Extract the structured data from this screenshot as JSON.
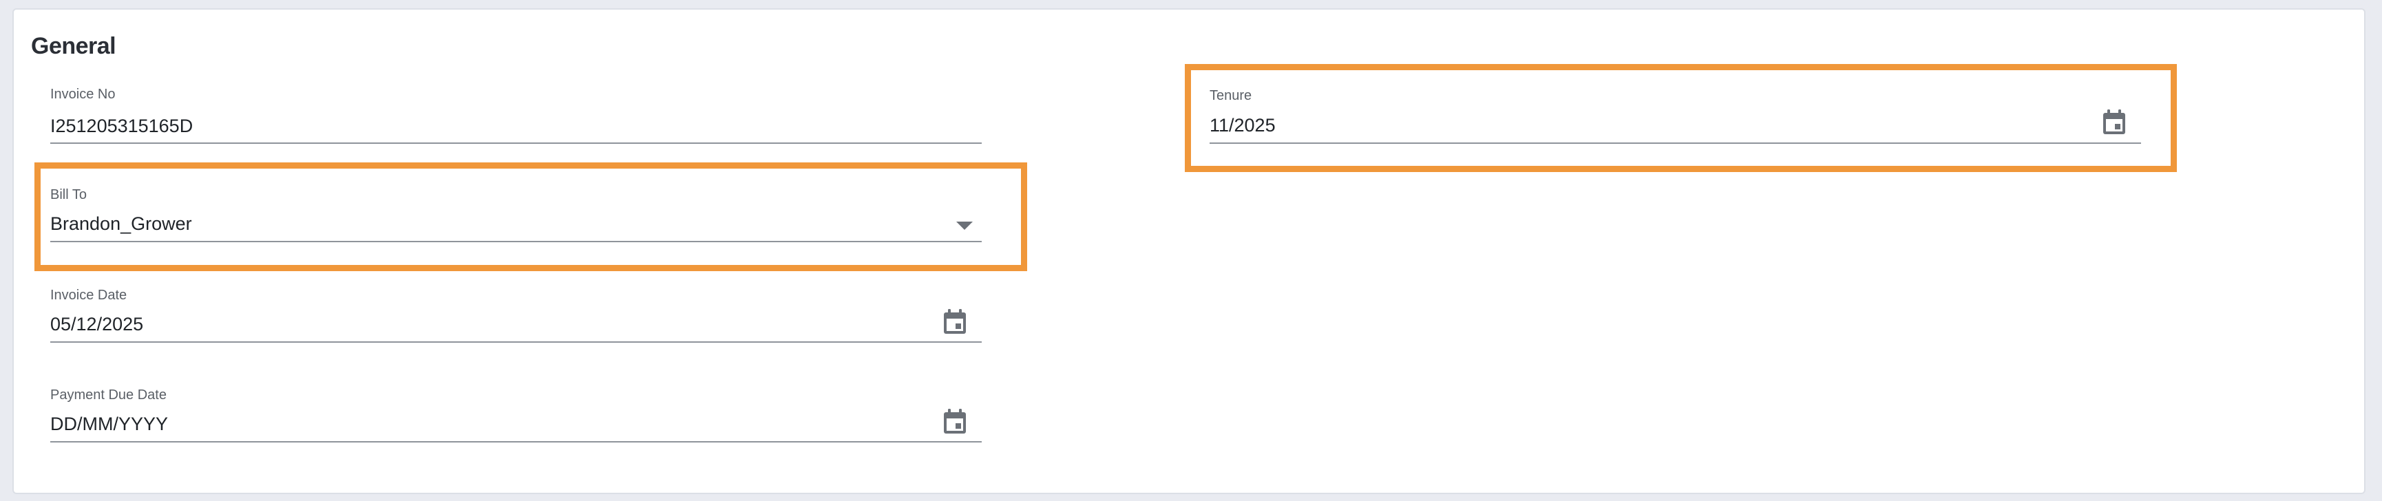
{
  "section": {
    "title": "General"
  },
  "fields": {
    "invoice_no": {
      "label": "Invoice No",
      "value": "I251205315165D"
    },
    "bill_to": {
      "label": "Bill To",
      "value": "Brandon_Grower"
    },
    "invoice_date": {
      "label": "Invoice Date",
      "value": "05/12/2025"
    },
    "payment_due_date": {
      "label": "Payment Due Date",
      "value": "",
      "placeholder": "DD/MM/YYYY"
    },
    "tenure": {
      "label": "Tenure",
      "value": "11/2025"
    }
  },
  "colors": {
    "highlight": "#f0973a",
    "underline": "#8f949b",
    "icon": "#6b7077"
  },
  "icons": {
    "calendar": "calendar-icon",
    "dropdown": "chevron-down-icon"
  }
}
